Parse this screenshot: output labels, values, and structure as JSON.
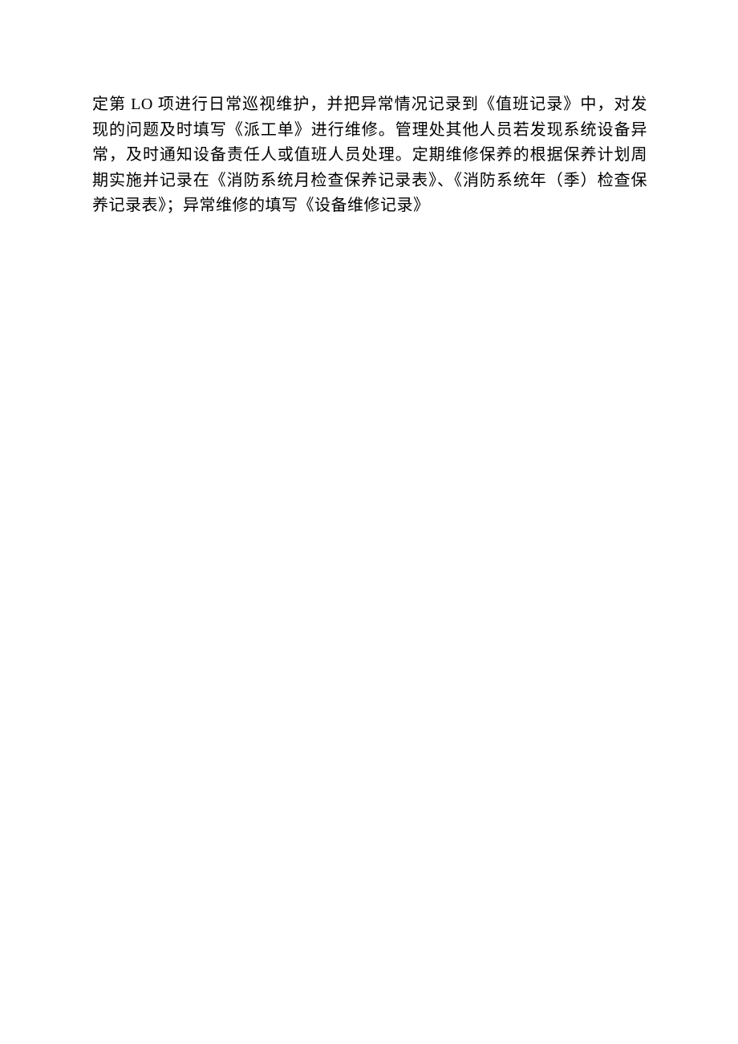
{
  "document": {
    "paragraph": "定第 LO 项进行日常巡视维护，并把异常情况记录到《值班记录》中，对发现的问题及时填写《派工单》进行维修。管理处其他人员若发现系统设备异常，及时通知设备责任人或值班人员处理。定期维修保养的根据保养计划周期实施并记录在《消防系统月检查保养记录表》、《消防系统年（季）检查保养记录表》；异常维修的填写《设备维修记录》"
  }
}
